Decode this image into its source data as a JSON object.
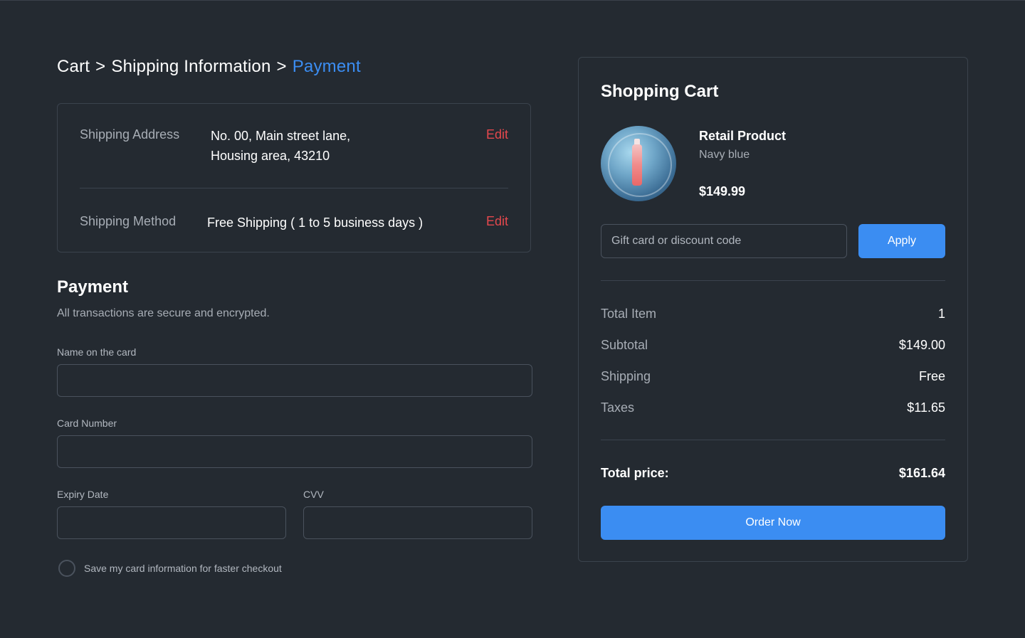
{
  "breadcrumb": {
    "items": [
      "Cart",
      "Shipping Information",
      "Payment"
    ],
    "separator": ">",
    "active_color": "#3b8df2"
  },
  "shipping": {
    "address_label": "Shipping Address",
    "address_line1": "No. 00, Main street lane,",
    "address_line2": "Housing area, 43210",
    "method_label": "Shipping Method",
    "method_value": "Free Shipping ( 1 to 5 business days )",
    "edit_label": "Edit"
  },
  "payment": {
    "title": "Payment",
    "subtitle": "All transactions are secure and encrypted.",
    "name_label": "Name on the card",
    "card_label": "Card Number",
    "expiry_label": "Expiry Date",
    "cvv_label": "CVV",
    "save_label": "Save my card information for faster checkout"
  },
  "cart": {
    "title": "Shopping Cart",
    "product": {
      "name": "Retail Product",
      "variant": "Navy blue",
      "price": "$149.99"
    },
    "discount_placeholder": "Gift card or discount code",
    "apply_label": "Apply",
    "summary": [
      {
        "label": "Total Item",
        "value": "1"
      },
      {
        "label": "Subtotal",
        "value": "$149.00"
      },
      {
        "label": "Shipping",
        "value": "Free"
      },
      {
        "label": "Taxes",
        "value": "$11.65"
      }
    ],
    "total_label": "Total price:",
    "total_value": "$161.64",
    "order_label": "Order Now"
  },
  "colors": {
    "background": "#242a31",
    "accent": "#3b8df2",
    "edit": "#e5484d"
  }
}
